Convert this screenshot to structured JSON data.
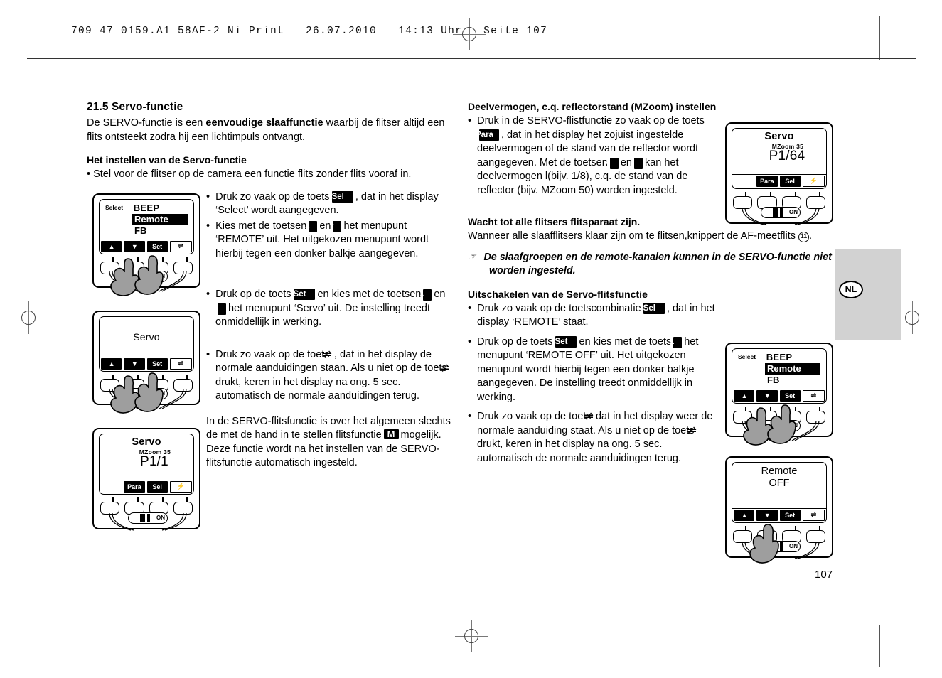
{
  "print_header": "709 47 0159.A1 58AF-2 Ni Print   26.07.2010   14:13 Uhr   Seite 107",
  "page_number": "107",
  "language_tab": "NL",
  "left_column": {
    "section_number_title": "21.5 Servo-functie",
    "intro_1": "De SERVO-functie is een ",
    "intro_bold": "eenvoudige slaaffunctie",
    "intro_2": " waarbij de flitser altijd een flits ontsteekt zodra hij een lichtimpuls ontvangt.",
    "sub_heading_1": "Het instellen van de Servo-functie",
    "bullet_1": "Stel voor de flitser op de camera een functie flits zonder flits vooraf in.",
    "bullet_2a": "Druk zo vaak op de toets",
    "bullet_2_key": "Sel",
    "bullet_2b": ", dat in het display ‘Select’ wordt aangegeven.",
    "bullet_3a": "Kies met de toetsen",
    "bullet_3_key_up": "▲",
    "bullet_3_mid": "en",
    "bullet_3_key_down": "▼",
    "bullet_3b": "het menupunt ‘REMOTE’ uit. Het uitgekozen menupunt wordt hierbij tegen een donker balkje aangegeven.",
    "bullet_4a": "Druk op de toets",
    "bullet_4_key": "Set",
    "bullet_4b": "en kies met de toetsen",
    "bullet_4_key_up": "▲",
    "bullet_4_mid": "en",
    "bullet_4_key_down": "▼",
    "bullet_4c": "het menupunt ‘Servo’ uit. De instelling treedt onmiddellijk in werking.",
    "bullet_5a": "Druk zo vaak op de toets",
    "bullet_5_key": "⇌",
    "bullet_5b": ", dat in het display de normale aanduidingen staan. Als u niet op de toets",
    "bullet_5_key2": "⇌",
    "bullet_5c": "drukt, keren in het display na ong. 5 sec. automatisch de normale aanduidingen terug.",
    "closing_1": "In de SERVO-flitsfunctie is over het algemeen slechts de met de hand in te stellen flitsfunctie",
    "closing_key": "M",
    "closing_2": "mogelijk. Deze functie wordt na het instellen van de SERVO-flitsfunctie automatisch ingesteld."
  },
  "right_column": {
    "heading_1": "Deelvermogen, c.q. reflectorstand (MZoom)  instellen",
    "bullet_1a": "Druk in de SERVO-flistfunctie zo vaak op de toets",
    "bullet_1_key": "Para",
    "bullet_1b": ", dat in het display het zojuist ingestelde deelvermogen of de  stand van de reflector wordt aangegeven. Met de toetsen",
    "bullet_1_key_plus": "+",
    "bullet_1_mid": "en",
    "bullet_1_key_minus": "–",
    "bullet_1c": "kan het deelvermogen l(bijv. 1/8), c.q. de stand van de reflector (bijv. MZoom 50) worden ingesteld.",
    "heading_2": "Wacht tot alle flitsers flitsparaat zijn.",
    "paragraph_2a": "Wanneer alle slaafflitsers klaar zijn om te flitsen,knippert de AF-meetflits",
    "paragraph_2_num": "11",
    "paragraph_2b": ".",
    "note_hand": "☞",
    "note_text": "De slaafgroepen en de remote-kanalen kunnen in de  SERVO-functie niet worden ingesteld.",
    "heading_3": "Uitschakelen van de Servo-flitsfunctie",
    "bullet_2a": "Druk zo vaak op de toetscombinatie",
    "bullet_2_key": "Sel",
    "bullet_2b": ", dat in het display ‘REMOTE’ staat.",
    "bullet_3a": "Druk op de toets",
    "bullet_3_key": "Set",
    "bullet_3b": "en kies met de toets",
    "bullet_3_key_up": "▲",
    "bullet_3c": "het menupunt ‘REMOTE OFF’ uit. Het uitgekozen menupunt wordt hierbij tegen een donker balkje aangegeven. De instelling treedt onmiddellijk in werking.",
    "bullet_4a": "Druk zo vaak op de toets",
    "bullet_4_key": "⇌",
    "bullet_4b": "dat in het display weer de normale aanduiding staat. Als u niet op de toets",
    "bullet_4_key2": "⇌",
    "bullet_4c": "drukt, keren in het display na ong. 5 sec. automatisch de normale aanduidingen terug."
  },
  "devices": {
    "select_remote_1": {
      "select_label": "Select",
      "beep_label": "BEEP",
      "menu": [
        "Remote",
        "FB"
      ],
      "highlight_index": 0,
      "softkeys": [
        "▲",
        "▼",
        "Set",
        "⇌"
      ],
      "power_label": "ON",
      "hands": 2
    },
    "servo_plain": {
      "center_label": "Servo",
      "softkeys": [
        "▲",
        "▼",
        "Set",
        "⇌"
      ],
      "power_label": "ON",
      "hands": 2
    },
    "servo_p1_1": {
      "title": "Servo",
      "sub": "MZoom  35",
      "value": "P1/1",
      "softkeys": [
        "",
        "Para",
        "Sel",
        "⚡"
      ],
      "power_label": "ON",
      "hands": 0
    },
    "servo_p1_64": {
      "title": "Servo",
      "sub": "MZoom  35",
      "value": "P1/64",
      "softkeys": [
        "",
        "Para",
        "Sel",
        "⚡"
      ],
      "power_label": "ON",
      "hands": 0
    },
    "select_remote_2": {
      "select_label": "Select",
      "beep_label": "BEEP",
      "menu": [
        "Remote",
        "FB"
      ],
      "highlight_index": 0,
      "softkeys": [
        "▲",
        "▼",
        "Set",
        "⇌"
      ],
      "power_label": "ON",
      "hands": 2
    },
    "remote_off": {
      "line1": "Remote",
      "line2": "OFF",
      "softkeys": [
        "▲",
        "▼",
        "Set",
        "⇌"
      ],
      "power_label": "ON",
      "hands": 1
    }
  }
}
